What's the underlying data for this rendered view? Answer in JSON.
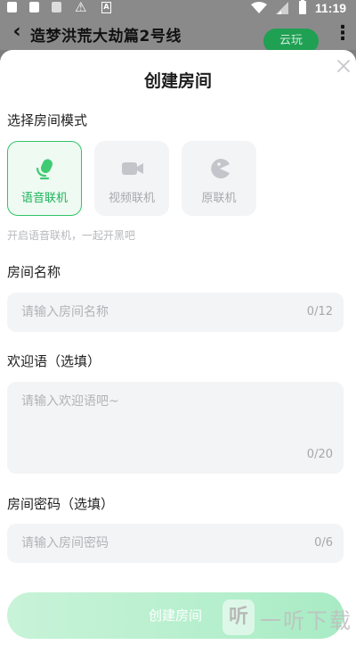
{
  "status_bar": {
    "time": "11:19",
    "badge_letter": "A",
    "icons": [
      "notification-square-icon",
      "notification-square-icon",
      "notification-file-icon",
      "warning-icon",
      "a-badge-icon",
      "wifi-icon",
      "signal-icon",
      "battery-icon"
    ]
  },
  "app_bar": {
    "title": "造梦洪荒大劫篇2号线",
    "cloud_play_label": "云玩",
    "icons": [
      "back-arrow-icon",
      "more-vertical-icon"
    ]
  },
  "dialog": {
    "title": "创建房间",
    "mode_section_label": "选择房间模式",
    "modes": [
      {
        "label": "语音联机",
        "icon": "microphone-icon",
        "selected": true
      },
      {
        "label": "视频联机",
        "icon": "video-camera-icon",
        "selected": false
      },
      {
        "label": "原联机",
        "icon": "pacman-icon",
        "selected": false
      }
    ],
    "mode_hint": "开启语音联机，一起开黑吧",
    "room_name": {
      "label": "房间名称",
      "placeholder": "请输入房间名称",
      "value": "",
      "counter": "0/12"
    },
    "welcome": {
      "label": "欢迎语（选填）",
      "placeholder": "请输入欢迎语吧~",
      "value": "",
      "counter": "0/20"
    },
    "password": {
      "label": "房间密码（选填）",
      "placeholder": "请输入房间密码",
      "value": "",
      "counter": "0/6"
    },
    "submit_label": "创建房间"
  },
  "watermark": {
    "logo": "听",
    "text": "一听下载"
  },
  "colors": {
    "accent": "#33c36a",
    "accent_text": "#1db25a",
    "cloud_button": "#1fa053",
    "field_bg": "#f3f4f6",
    "overlay": "#8a8a8a"
  }
}
